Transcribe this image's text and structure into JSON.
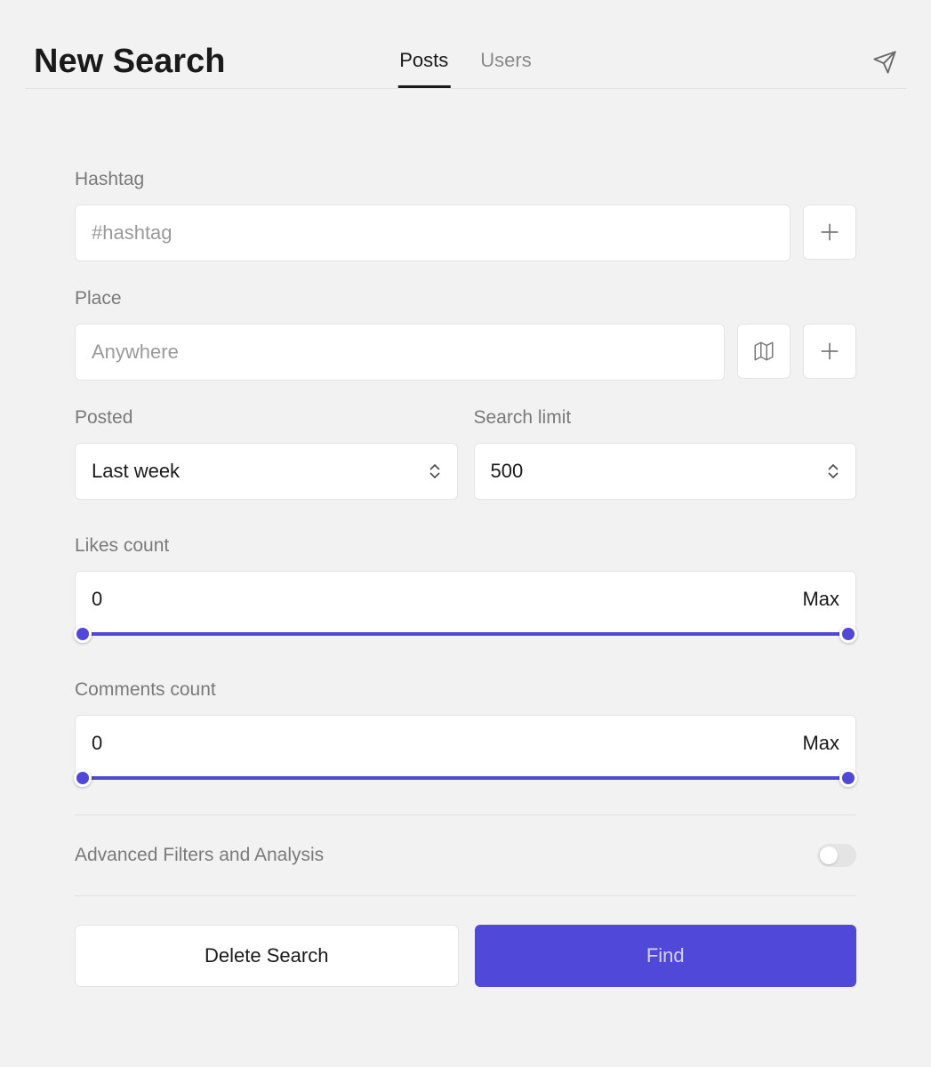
{
  "header": {
    "title": "New Search",
    "tabs": {
      "posts": "Posts",
      "users": "Users",
      "active": "posts"
    }
  },
  "hashtag": {
    "label": "Hashtag",
    "placeholder": "#hashtag",
    "value": ""
  },
  "place": {
    "label": "Place",
    "placeholder": "Anywhere",
    "value": ""
  },
  "posted": {
    "label": "Posted",
    "value": "Last week"
  },
  "searchLimit": {
    "label": "Search limit",
    "value": "500"
  },
  "likes": {
    "label": "Likes count",
    "min": "0",
    "max": "Max"
  },
  "comments": {
    "label": "Comments count",
    "min": "0",
    "max": "Max"
  },
  "advanced": {
    "label": "Advanced Filters and Analysis",
    "enabled": false
  },
  "buttons": {
    "delete": "Delete Search",
    "find": "Find"
  },
  "colors": {
    "accent": "#5048d8"
  }
}
